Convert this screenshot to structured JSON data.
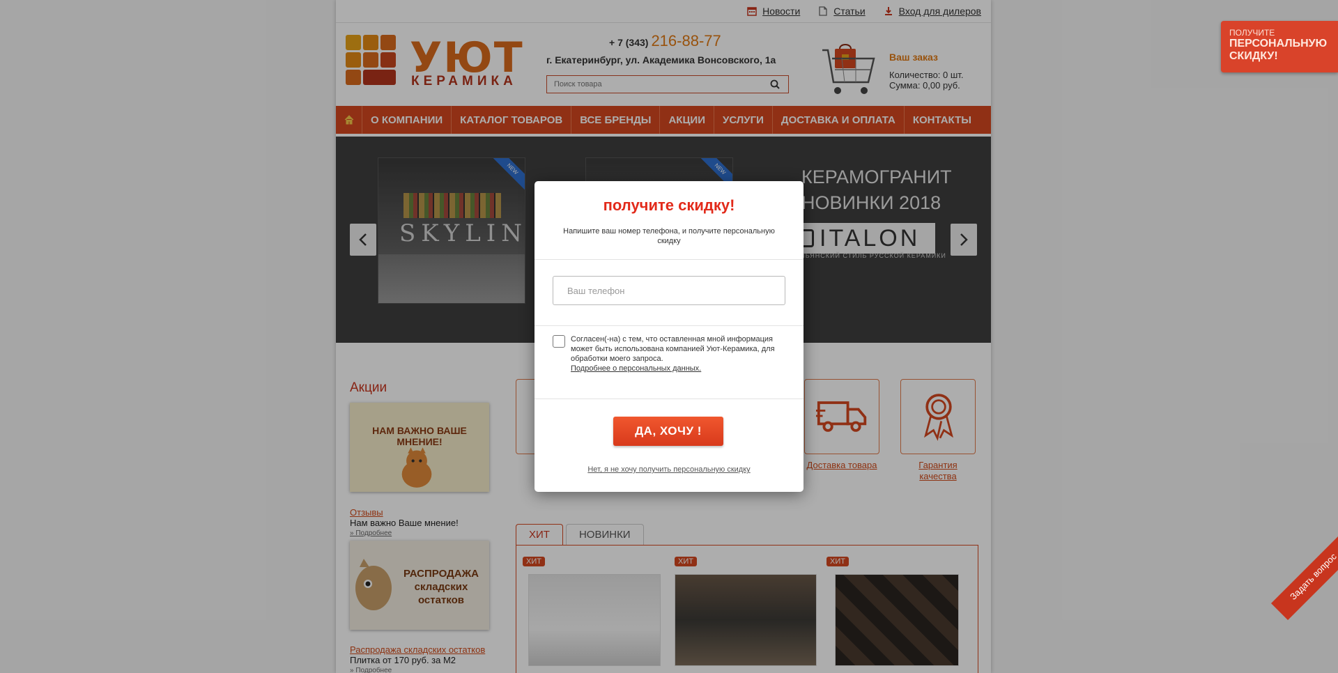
{
  "top_links": [
    {
      "label": "Новости",
      "icon": "calendar-icon"
    },
    {
      "label": "Статьи",
      "icon": "document-icon"
    },
    {
      "label": "Вход для дилеров",
      "icon": "download-icon"
    }
  ],
  "logo": {
    "word": "УЮТ",
    "sub": "КЕРАМИКА"
  },
  "contact": {
    "phone_prefix": "+ 7 (343)",
    "phone_number": "216-88-77",
    "address": "г. Екатеринбург, ул. Академика Вонсовского, 1а"
  },
  "search": {
    "placeholder": "Поиск товара"
  },
  "order": {
    "title": "Ваш заказ",
    "quantity": "Количество: 0 шт.",
    "sum": "Сумма: 0,00 руб."
  },
  "nav": {
    "items": [
      "О КОМПАНИИ",
      "КАТАЛОГ ТОВАРОВ",
      "ВСЕ БРЕНДЫ",
      "АКЦИИ",
      "УСЛУГИ",
      "ДОСТАВКА И ОПЛАТА",
      "КОНТАКТЫ"
    ]
  },
  "slider": {
    "slide_text": "SKYLINE",
    "badge": "NEW",
    "promo_line1": "КЕРАМОГРАНИТ",
    "promo_line2": "НОВИНКИ 2018",
    "brand": "ITALON",
    "brand_sub": "ИТАЛЬЯНСКИЙ СТИЛЬ РУССКОЙ КЕРАМИКИ"
  },
  "sidebar": {
    "title": "Акции",
    "card1_text": "НАМ ВАЖНО ВАШЕ МНЕНИЕ!",
    "link1": "Отзывы",
    "text1": "Нам важно Ваше мнение!",
    "more": "» Подробнее",
    "card2_text": "РАСПРОДАЖА складских остатков",
    "link2": "Распродажа складских остатков",
    "text2": "Плитка от 170 руб. за М2"
  },
  "features": [
    {
      "label": "Доставка товара",
      "icon": "truck-icon"
    },
    {
      "label": "Гарантия качества",
      "icon": "award-ribbon-icon"
    }
  ],
  "tabs": [
    "ХИТ",
    "НОВИНКИ"
  ],
  "hit_badge": "ХИТ",
  "side_promo": {
    "line1": "ПОЛУЧИТЕ",
    "line2": "ПЕРСОНАЛЬНУЮ",
    "line3": "СКИДКУ!"
  },
  "ask_question": "Задать вопрос",
  "modal": {
    "title": "получите скидку!",
    "subtitle": "Напишите ваш номер телефона, и получите персональную скидку",
    "phone_placeholder": "Ваш телефон",
    "consent": "Согласен(-на) с тем, что оставленная мной информация может быть использована компанией Уют-Керамика, для обработки моего запроса.",
    "consent_link": "Подробнее о персональных данных.",
    "cta": "ДА, ХОЧУ !",
    "decline": "Нет, я не хочу получить персональную скидку"
  },
  "colors": {
    "accent": "#d4471f",
    "orange": "#e07a14",
    "title_red": "#e22a1a"
  }
}
